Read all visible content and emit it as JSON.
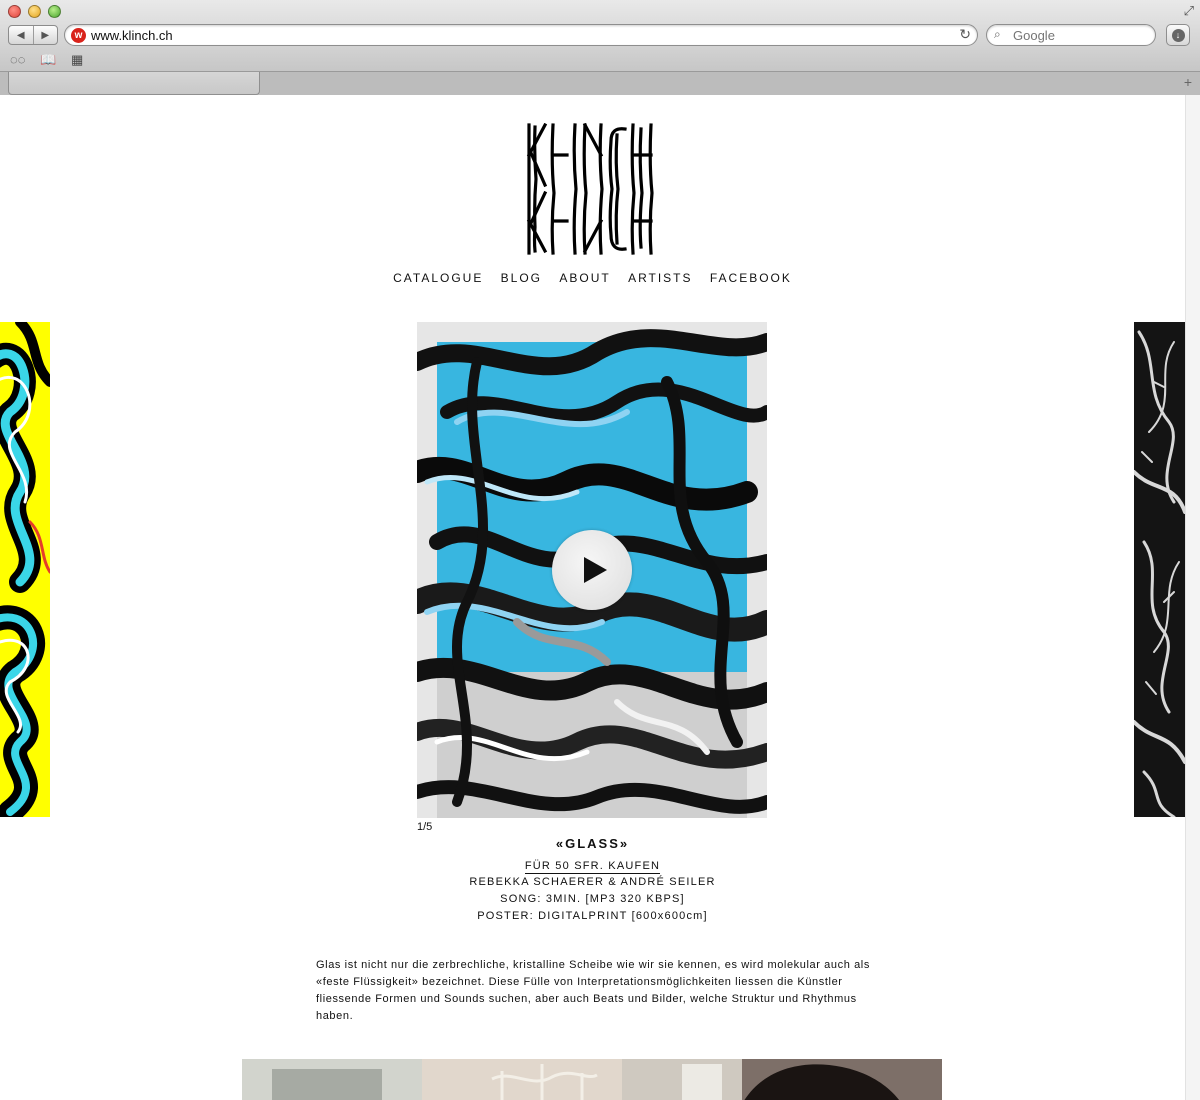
{
  "browser": {
    "url": "www.klinch.ch",
    "search_placeholder": "Google",
    "site_icon_glyph": "w",
    "nav_back": "◀",
    "nav_forward": "▶",
    "reload_glyph": "↻",
    "search_glyph": "⌕",
    "downloads_glyph": "↓",
    "reader_glyph": "◌◌",
    "bookmarks_glyph": "📖",
    "topsites_glyph": "▦",
    "new_tab_glyph": "+",
    "fullscreen_glyph": "⤢"
  },
  "site": {
    "logo_text": "KLINCH",
    "nav": [
      "CATALOGUE",
      "BLOG",
      "ABOUT",
      "ARTISTS",
      "FACEBOOK"
    ]
  },
  "release": {
    "counter": "1/5",
    "title": "«GLASS»",
    "buy_label": "FÜR 50 SFR. KAUFEN",
    "artists": "REBEKKA SCHAERER & ANDRÉ SEILER",
    "song": "SONG: 3MIN. [MP3 320 KBPS]",
    "poster": "POSTER: DIGITALPRINT [600x600cm]",
    "description": "Glas ist nicht nur die zerbrechliche, kristalline Scheibe wie wir sie kennen, es wird molekular auch als «feste Flüssigkeit» bezeichnet. Diese Fülle von Interpretationsmöglichkeiten liessen die Künstler fliessende Formen und Sounds suchen, aber auch Beats und Bilder, welche Struktur und Rhythmus haben."
  },
  "colors": {
    "left_art_yellow": "#ffff00",
    "left_art_cyan": "#3ad6e8",
    "main_art_blue": "#38b6e0",
    "main_art_light_blue": "#8fd3f2"
  }
}
